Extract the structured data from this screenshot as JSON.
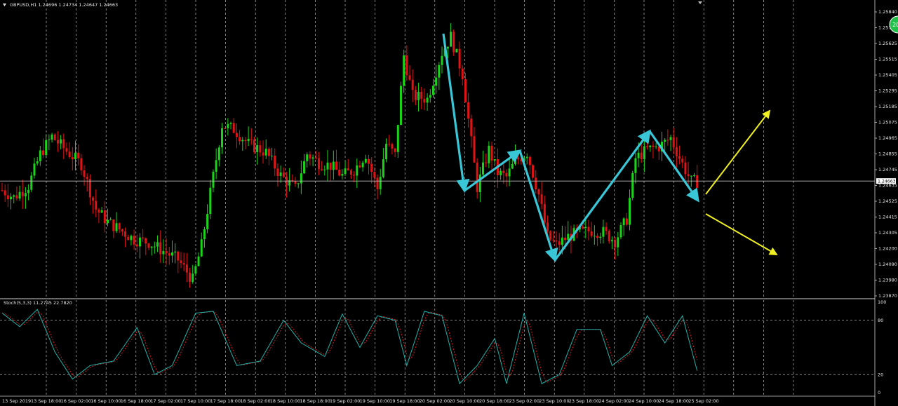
{
  "header": {
    "symbol_title": "GBPUSD,H1  1.24696 1.24734 1.24647 1.24663",
    "stoch_title": "Stoch(5,3,3) 11.2745 22.7820"
  },
  "colors": {
    "background": "#000000",
    "bull": "#19d419",
    "bear": "#e01414",
    "grid": "#ffffff",
    "stoch_main": "#20b2aa",
    "stoch_signal": "#e02020",
    "zigzag": "#39c6d6",
    "projection": "#f0f020",
    "price_line": "#c0c0c0",
    "badge": "#23c04a"
  },
  "price_axis": {
    "ticks": [
      "1.25840",
      "1.2573",
      "1.25625",
      "1.25515",
      "1.25405",
      "1.25295",
      "1.25185",
      "1.25075",
      "1.24965",
      "1.24855",
      "1.24745",
      "1.24635",
      "1.24525",
      "1.24415",
      "1.24305",
      "1.24200",
      "1.24090",
      "1.23980",
      "1.23870"
    ],
    "current_price": "1.24663",
    "badge_text": "20"
  },
  "stoch_axis": {
    "ticks": [
      "100",
      "80",
      "20",
      "0"
    ]
  },
  "time_axis": {
    "labels": [
      "13 Sep 2019",
      "13 Sep 18:00",
      "16 Sep 02:00",
      "16 Sep 10:00",
      "16 Sep 18:00",
      "17 Sep 02:00",
      "17 Sep 10:00",
      "17 Sep 18:00",
      "18 Sep 02:00",
      "18 Sep 10:00",
      "18 Sep 18:00",
      "19 Sep 02:00",
      "19 Sep 10:00",
      "19 Sep 18:00",
      "20 Sep 02:00",
      "20 Sep 10:00",
      "20 Sep 18:00",
      "23 Sep 02:00",
      "23 Sep 10:00",
      "23 Sep 18:00",
      "24 Sep 02:00",
      "24 Sep 10:00",
      "24 Sep 18:00",
      "25 Sep 02:00"
    ]
  },
  "chart_data": {
    "type": "candlestick",
    "symbol": "GBPUSD",
    "timeframe": "H1",
    "ylim": [
      1.2387,
      1.2584
    ],
    "anchors": [
      [
        0,
        1.246
      ],
      [
        4,
        1.2455
      ],
      [
        9,
        1.2463
      ],
      [
        13,
        1.2485
      ],
      [
        17,
        1.2497
      ],
      [
        22,
        1.2487
      ],
      [
        27,
        1.2478
      ],
      [
        32,
        1.2447
      ],
      [
        36,
        1.2438
      ],
      [
        40,
        1.2433
      ],
      [
        45,
        1.2426
      ],
      [
        50,
        1.2424
      ],
      [
        55,
        1.2418
      ],
      [
        60,
        1.2412
      ],
      [
        65,
        1.2398
      ],
      [
        68,
        1.2422
      ],
      [
        71,
        1.2458
      ],
      [
        75,
        1.2505
      ],
      [
        79,
        1.2502
      ],
      [
        84,
        1.2492
      ],
      [
        90,
        1.2486
      ],
      [
        95,
        1.247
      ],
      [
        100,
        1.2461
      ],
      [
        104,
        1.2485
      ],
      [
        108,
        1.2479
      ],
      [
        112,
        1.2477
      ],
      [
        116,
        1.247
      ],
      [
        120,
        1.2474
      ],
      [
        124,
        1.2485
      ],
      [
        128,
        1.2461
      ],
      [
        131,
        1.2492
      ],
      [
        134,
        1.2484
      ],
      [
        137,
        1.2553
      ],
      [
        140,
        1.2525
      ],
      [
        145,
        1.2523
      ],
      [
        150,
        1.2555
      ],
      [
        153,
        1.2566
      ],
      [
        157,
        1.254
      ],
      [
        162,
        1.2462
      ],
      [
        166,
        1.2488
      ],
      [
        169,
        1.2472
      ],
      [
        172,
        1.2469
      ],
      [
        175,
        1.248
      ],
      [
        179,
        1.2486
      ],
      [
        183,
        1.2457
      ],
      [
        186,
        1.2428
      ],
      [
        189,
        1.2422
      ],
      [
        193,
        1.2428
      ],
      [
        197,
        1.2431
      ],
      [
        201,
        1.2432
      ],
      [
        205,
        1.2431
      ],
      [
        209,
        1.2425
      ],
      [
        213,
        1.244
      ],
      [
        216,
        1.2482
      ],
      [
        220,
        1.2488
      ],
      [
        224,
        1.249
      ],
      [
        228,
        1.2496
      ],
      [
        232,
        1.2478
      ],
      [
        235,
        1.2466
      ]
    ],
    "stoch_anchors": [
      [
        0,
        88
      ],
      [
        6,
        73
      ],
      [
        12,
        92
      ],
      [
        18,
        45
      ],
      [
        24,
        15
      ],
      [
        30,
        30
      ],
      [
        38,
        35
      ],
      [
        46,
        72
      ],
      [
        52,
        20
      ],
      [
        58,
        30
      ],
      [
        66,
        88
      ],
      [
        72,
        90
      ],
      [
        80,
        30
      ],
      [
        88,
        35
      ],
      [
        96,
        80
      ],
      [
        102,
        55
      ],
      [
        110,
        40
      ],
      [
        116,
        87
      ],
      [
        122,
        50
      ],
      [
        128,
        85
      ],
      [
        134,
        80
      ],
      [
        138,
        30
      ],
      [
        144,
        90
      ],
      [
        150,
        85
      ],
      [
        156,
        10
      ],
      [
        162,
        30
      ],
      [
        168,
        60
      ],
      [
        172,
        10
      ],
      [
        178,
        88
      ],
      [
        184,
        10
      ],
      [
        190,
        20
      ],
      [
        196,
        70
      ],
      [
        204,
        70
      ],
      [
        208,
        30
      ],
      [
        214,
        45
      ],
      [
        220,
        85
      ],
      [
        226,
        55
      ],
      [
        232,
        85
      ],
      [
        238,
        12
      ]
    ]
  }
}
